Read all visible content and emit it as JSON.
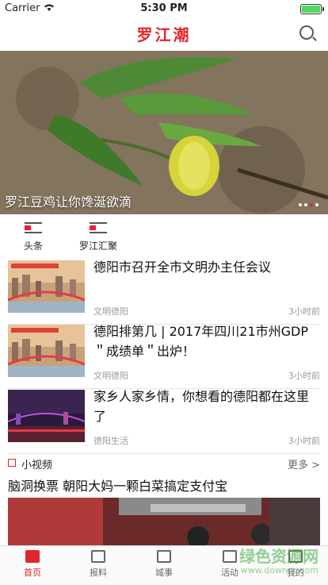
{
  "status": {
    "carrier": "Carrier",
    "time": "5:30 PM"
  },
  "header": {
    "logo": "罗江潮"
  },
  "banner": {
    "caption": "罗江豆鸡让你馋涎欲滴",
    "slides": 4,
    "active": 3
  },
  "channels": [
    {
      "label": "头条"
    },
    {
      "label": "罗江汇聚"
    }
  ],
  "news": [
    {
      "title": "德阳市召开全市文明办主任会议",
      "source": "文明德阳",
      "time": "3小时前"
    },
    {
      "title": "德阳排第几 | 2017年四川21市州GDP ＂成绩单＂出炉！",
      "source": "文明德阳",
      "time": "3小时前"
    },
    {
      "title": "家乡人家乡情，你想看的德阳都在这里了",
      "source": "德阳生活",
      "time": "3小时前"
    }
  ],
  "video": {
    "section": "小视频",
    "more": "更多 >",
    "title": "脑洞换票 朝阳大妈一颗白菜搞定支付宝"
  },
  "tabs": [
    {
      "label": "首页",
      "icon": "home-icon"
    },
    {
      "label": "报料",
      "icon": "image-icon"
    },
    {
      "label": "城事",
      "icon": "building-icon"
    },
    {
      "label": "活动",
      "icon": "activity-icon"
    },
    {
      "label": "我的",
      "icon": "user-icon"
    }
  ],
  "watermark": {
    "line1": "绿色资源网",
    "line2": "www.downcc.com"
  },
  "colors": {
    "brand": "#e0262b",
    "battery": "#4cd964"
  }
}
